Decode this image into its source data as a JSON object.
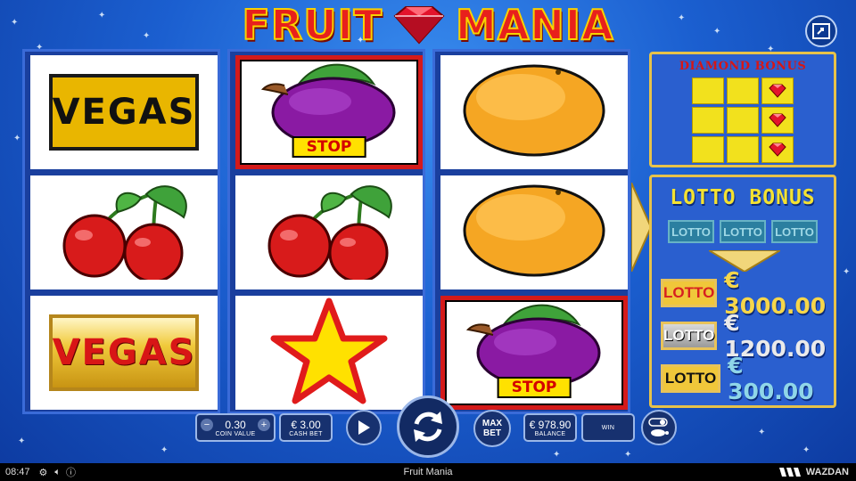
{
  "title": {
    "left_word": "FRUIT",
    "right_word": "MANIA"
  },
  "reels": [
    [
      {
        "symbol": "vegas",
        "label": "VEGAS",
        "style": "plain"
      },
      {
        "symbol": "cherries"
      },
      {
        "symbol": "vegas",
        "label": "VEGAS",
        "style": "gold"
      }
    ],
    [
      {
        "symbol": "plum",
        "stop": "STOP"
      },
      {
        "symbol": "cherries"
      },
      {
        "symbol": "star"
      }
    ],
    [
      {
        "symbol": "orange"
      },
      {
        "symbol": "orange"
      },
      {
        "symbol": "plum",
        "stop": "STOP"
      }
    ]
  ],
  "diamond_bonus": {
    "title": "DIAMOND BONUS",
    "diamond_cells": [
      2,
      5,
      8
    ]
  },
  "lotto_bonus": {
    "title": "LOTTO BONUS",
    "slots": [
      "LOTTO",
      "LOTTO",
      "LOTTO"
    ],
    "prizes": [
      {
        "badge": "LOTTO",
        "value": "€ 3000.00",
        "badge_color": "#d62020",
        "value_color": "#f6d64a"
      },
      {
        "badge": "LOTTO",
        "value": "€ 1200.00",
        "badge_color": "#ffffff",
        "value_color": "#eaeaea"
      },
      {
        "badge": "LOTTO",
        "value": "€ 300.00",
        "badge_color": "#111111",
        "value_color": "#8fd6e8"
      }
    ]
  },
  "controls": {
    "coin_minus": "−",
    "coin_value": "0.30",
    "coin_plus": "+",
    "coin_label": "COIN VALUE",
    "cash_bet_value": "€ 3.00",
    "cash_bet_label": "CASH BET",
    "max_bet": [
      "MAX",
      "BET"
    ],
    "balance_value": "€ 978.90",
    "balance_label": "BALANCE",
    "win_value": "",
    "win_label": "WIN"
  },
  "status_bar": {
    "time": "08:47",
    "game_name": "Fruit Mania",
    "brand": "WAZDAN"
  },
  "colors": {
    "background": "#1b5fd0",
    "title_red": "#e8201c",
    "frame_gold": "#e7c24a",
    "stop_red": "#d41a1a"
  }
}
